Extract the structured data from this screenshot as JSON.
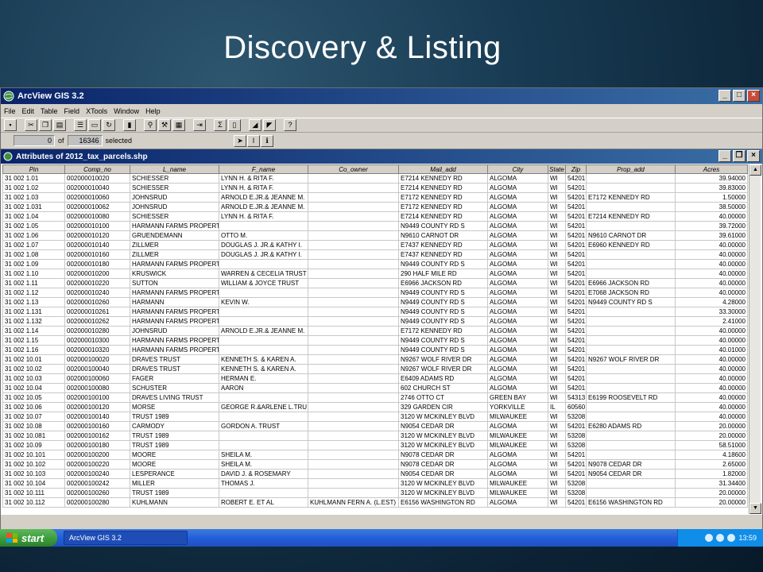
{
  "slide": {
    "title": "Discovery & Listing"
  },
  "app": {
    "title": "ArcView GIS 3.2",
    "menu": [
      "File",
      "Edit",
      "Table",
      "Field",
      "XTools",
      "Window",
      "Help"
    ],
    "status": {
      "selected_count": "0",
      "of_label": "of",
      "total_count": "16346",
      "selected_label": "selected"
    }
  },
  "table_window": {
    "title": "Attributes of 2012_tax_parcels.shp",
    "columns": [
      "Pin",
      "Comp_no",
      "L_name",
      "F_name",
      "Co_owner",
      "Mail_add",
      "City",
      "State",
      "Zip",
      "Prop_add",
      "Acres"
    ],
    "rows": [
      [
        "31 002 1.01",
        "002000010020",
        "SCHIESSER",
        "LYNN H. & RITA F.",
        "",
        "E7214 KENNEDY RD",
        "ALGOMA",
        "WI",
        "54201",
        "",
        "39.94000"
      ],
      [
        "31 002 1.02",
        "002000010040",
        "SCHIESSER",
        "LYNN H. & RITA F.",
        "",
        "E7214 KENNEDY RD",
        "ALGOMA",
        "WI",
        "54201",
        "",
        "39.83000"
      ],
      [
        "31 002 1.03",
        "002000010060",
        "JOHNSRUD",
        "ARNOLD E.JR.& JEANNE M.",
        "",
        "E7172 KENNEDY RD",
        "ALGOMA",
        "WI",
        "54201",
        "E7172 KENNEDY RD",
        "1.50000"
      ],
      [
        "31 002 1.031",
        "002000010062",
        "JOHNSRUD",
        "ARNOLD E.JR.& JEANNE M.",
        "",
        "E7172 KENNEDY RD",
        "ALGOMA",
        "WI",
        "54201",
        "",
        "38.50000"
      ],
      [
        "31 002 1.04",
        "002000010080",
        "SCHIESSER",
        "LYNN H. & RITA F.",
        "",
        "E7214 KENNEDY RD",
        "ALGOMA",
        "WI",
        "54201",
        "E7214 KENNEDY RD",
        "40.00000"
      ],
      [
        "31 002 1.05",
        "002000010100",
        "HARMANN FARMS PROPERT",
        "",
        "",
        "N9449 COUNTY RD S",
        "ALGOMA",
        "WI",
        "54201",
        "",
        "39.72000"
      ],
      [
        "31 002 1.06",
        "002000010120",
        "GRUENDEMANN",
        "OTTO M.",
        "",
        "N9610 CARNOT DR",
        "ALGOMA",
        "WI",
        "54201",
        "N9610 CARNOT DR",
        "39.61000"
      ],
      [
        "31 002 1.07",
        "002000010140",
        "ZILLMER",
        "DOUGLAS J. JR.& KATHY I.",
        "",
        "E7437 KENNEDY RD",
        "ALGOMA",
        "WI",
        "54201",
        "E6960 KENNEDY RD",
        "40.00000"
      ],
      [
        "31 002 1.08",
        "002000010160",
        "ZILLMER",
        "DOUGLAS J. JR.& KATHY I.",
        "",
        "E7437 KENNEDY RD",
        "ALGOMA",
        "WI",
        "54201",
        "",
        "40.00000"
      ],
      [
        "31 002 1.09",
        "002000010180",
        "HARMANN FARMS PROPERT",
        "",
        "",
        "N9449 COUNTY RD S",
        "ALGOMA",
        "WI",
        "54201",
        "",
        "40.00000"
      ],
      [
        "31 002 1.10",
        "002000010200",
        "KRUSWICK",
        "WARREN & CECELIA TRUST",
        "",
        "290 HALF MILE RD",
        "ALGOMA",
        "WI",
        "54201",
        "",
        "40.00000"
      ],
      [
        "31 002 1.11",
        "002000010220",
        "SUTTON",
        "WILLIAM & JOYCE TRUST",
        "",
        "E6966 JACKSON RD",
        "ALGOMA",
        "WI",
        "54201",
        "E6966 JACKSON RD",
        "40.00000"
      ],
      [
        "31 002 1.12",
        "002000010240",
        "HARMANN FARMS PROPERT",
        "",
        "",
        "N9449 COUNTY RD S",
        "ALGOMA",
        "WI",
        "54201",
        "E7068 JACKSON RD",
        "40.00000"
      ],
      [
        "31 002 1.13",
        "002000010260",
        "HARMANN",
        "KEVIN W.",
        "",
        "N9449 COUNTY RD S",
        "ALGOMA",
        "WI",
        "54201",
        "N9449 COUNTY RD S",
        "4.28000"
      ],
      [
        "31 002 1.131",
        "002000010261",
        "HARMANN FARMS PROPERT",
        "",
        "",
        "N9449 COUNTY RD S",
        "ALGOMA",
        "WI",
        "54201",
        "",
        "33.30000"
      ],
      [
        "31 002 1.132",
        "002000010262",
        "HARMANN FARMS PROPERT",
        "",
        "",
        "N9449 COUNTY RD S",
        "ALGOMA",
        "WI",
        "54201",
        "",
        "2.41000"
      ],
      [
        "31 002 1.14",
        "002000010280",
        "JOHNSRUD",
        "ARNOLD E.JR.& JEANNE M.",
        "",
        "E7172 KENNEDY RD",
        "ALGOMA",
        "WI",
        "54201",
        "",
        "40.00000"
      ],
      [
        "31 002 1.15",
        "002000010300",
        "HARMANN FARMS PROPERT",
        "",
        "",
        "N9449 COUNTY RD S",
        "ALGOMA",
        "WI",
        "54201",
        "",
        "40.00000"
      ],
      [
        "31 002 1.16",
        "002000010320",
        "HARMANN FARMS PROPERT",
        "",
        "",
        "N9449 COUNTY RD S",
        "ALGOMA",
        "WI",
        "54201",
        "",
        "40.01000"
      ],
      [
        "31 002 10.01",
        "002000100020",
        "DRAVES TRUST",
        "KENNETH S. & KAREN A.",
        "",
        "N9267 WOLF RIVER DR",
        "ALGOMA",
        "WI",
        "54201",
        "N9267 WOLF RIVER DR",
        "40.00000"
      ],
      [
        "31 002 10.02",
        "002000100040",
        "DRAVES TRUST",
        "KENNETH S. & KAREN A.",
        "",
        "N9267 WOLF RIVER DR",
        "ALGOMA",
        "WI",
        "54201",
        "",
        "40.00000"
      ],
      [
        "31 002 10.03",
        "002000100060",
        "FAGER",
        "HERMAN E.",
        "",
        "E6409 ADAMS RD",
        "ALGOMA",
        "WI",
        "54201",
        "",
        "40.00000"
      ],
      [
        "31 002 10.04",
        "002000100080",
        "SCHUSTER",
        "AARON",
        "",
        "602 CHURCH ST",
        "ALGOMA",
        "WI",
        "54201",
        "",
        "40.00000"
      ],
      [
        "31 002 10.05",
        "002000100100",
        "DRAVES LIVING TRUST",
        "",
        "",
        "2746 OTTO CT",
        "GREEN BAY",
        "WI",
        "54313",
        "E6199 ROOSEVELT RD",
        "40.00000"
      ],
      [
        "31 002 10.06",
        "002000100120",
        "MORSE",
        "GEORGE R.&ARLENE L.TRU",
        "",
        "329 GARDEN CIR",
        "YORKVILLE",
        "IL",
        "60560",
        "",
        "40.00000"
      ],
      [
        "31 002 10.07",
        "002000100140",
        "TRUST 1989",
        "",
        "",
        "3120 W MCKINLEY BLVD",
        "MILWAUKEE",
        "WI",
        "53208",
        "",
        "40.00000"
      ],
      [
        "31 002 10.08",
        "002000100160",
        "CARMODY",
        "GORDON A. TRUST",
        "",
        "N9054 CEDAR DR",
        "ALGOMA",
        "WI",
        "54201",
        "E6280 ADAMS RD",
        "20.00000"
      ],
      [
        "31 002 10.081",
        "002000100162",
        "TRUST 1989",
        "",
        "",
        "3120 W MCKINLEY BLVD",
        "MILWAUKEE",
        "WI",
        "53208",
        "",
        "20.00000"
      ],
      [
        "31 002 10.09",
        "002000100180",
        "TRUST 1989",
        "",
        "",
        "3120 W MCKINLEY BLVD",
        "MILWAUKEE",
        "WI",
        "53208",
        "",
        "58.51000"
      ],
      [
        "31 002 10.101",
        "002000100200",
        "MOORE",
        "SHEILA M.",
        "",
        "N9078 CEDAR DR",
        "ALGOMA",
        "WI",
        "54201",
        "",
        "4.18600"
      ],
      [
        "31 002 10.102",
        "002000100220",
        "MOORE",
        "SHEILA M.",
        "",
        "N9078 CEDAR DR",
        "ALGOMA",
        "WI",
        "54201",
        "N9078 CEDAR DR",
        "2.65000"
      ],
      [
        "31 002 10.103",
        "002000100240",
        "LESPERANCE",
        "DAVID J. & ROSEMARY",
        "",
        "N9054 CEDAR DR",
        "ALGOMA",
        "WI",
        "54201",
        "N9054 CEDAR DR",
        "1.82000"
      ],
      [
        "31 002 10.104",
        "002000100242",
        "MILLER",
        "THOMAS J.",
        "",
        "3120 W MCKINLEY BLVD",
        "MILWAUKEE",
        "WI",
        "53208",
        "",
        "31.34400"
      ],
      [
        "31 002 10.111",
        "002000100260",
        "TRUST 1989",
        "",
        "",
        "3120 W MCKINLEY BLVD",
        "MILWAUKEE",
        "WI",
        "53208",
        "",
        "20.00000"
      ],
      [
        "31 002 10.112",
        "002000100280",
        "KUHLMANN",
        "ROBERT E. ET AL",
        "KUHLMANN FERN A. (L.EST)",
        "E6156 WASHINGTON RD",
        "ALGOMA",
        "WI",
        "54201",
        "E6156 WASHINGTON RD",
        "20.00000"
      ]
    ]
  },
  "taskbar": {
    "start_label": "start",
    "task_label": "ArcView GIS 3.2",
    "clock": "13:59"
  }
}
